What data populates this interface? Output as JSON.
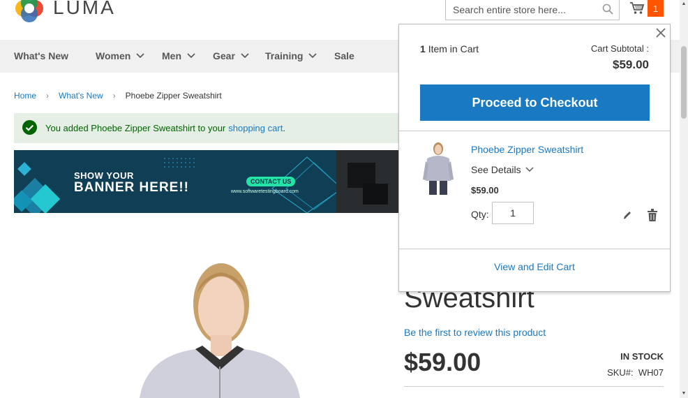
{
  "header": {
    "logo_text": "LUMA",
    "search_placeholder": "Search entire store here...",
    "cart_count": "1"
  },
  "nav": {
    "items": [
      {
        "label": "What's New",
        "dropdown": false
      },
      {
        "label": "Women",
        "dropdown": true
      },
      {
        "label": "Men",
        "dropdown": true
      },
      {
        "label": "Gear",
        "dropdown": true
      },
      {
        "label": "Training",
        "dropdown": true
      },
      {
        "label": "Sale",
        "dropdown": false
      }
    ]
  },
  "breadcrumb": [
    "Home",
    "What's New",
    "Phoebe Zipper Sweatshirt"
  ],
  "message": {
    "text": "You added Phoebe Zipper Sweatshirt to your",
    "link": "shopping cart",
    "suffix": "."
  },
  "banner": {
    "line1": "SHOW YOUR",
    "line2": "BANNER HERE!!",
    "contact": "CONTACT US",
    "url": "www.softwaretestingboard.com"
  },
  "product": {
    "title": "Sweatshirt",
    "review_link": "Be the first to review this product",
    "price": "$59.00",
    "stock": "IN STOCK",
    "sku_label": "SKU#:",
    "sku": "WH07"
  },
  "minicart": {
    "items_count": "1",
    "items_label": "Item in Cart",
    "subtotal_label": "Cart Subtotal :",
    "subtotal": "$59.00",
    "checkout_label": "Proceed to Checkout",
    "item": {
      "name": "Phoebe Zipper Sweatshirt",
      "see_details": "See Details",
      "price": "$59.00",
      "qty_label": "Qty:",
      "qty": "1"
    },
    "view_cart": "View and Edit Cart"
  },
  "colors": {
    "accent": "#1979c3",
    "cart_badge": "#ff5501",
    "success_bg": "#e5efe5",
    "success_text": "#006400",
    "banner_bg": "#103f55"
  }
}
